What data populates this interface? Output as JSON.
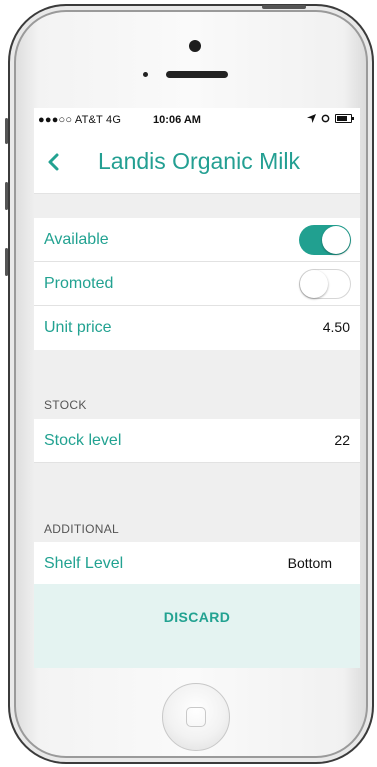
{
  "status_bar": {
    "carrier": "●●●○○ AT&T  4G",
    "time": "10:06 AM"
  },
  "header": {
    "title": "Landis Organic Milk",
    "back_icon": "chevron-left-icon"
  },
  "general": {
    "available_label": "Available",
    "available_on": true,
    "promoted_label": "Promoted",
    "promoted_on": false,
    "unit_price_label": "Unit price",
    "unit_price_value": "4.50"
  },
  "stock": {
    "section_title": "STOCK",
    "level_label": "Stock level",
    "level_value": "22"
  },
  "additional": {
    "section_title": "ADDITIONAL",
    "shelf_label": "Shelf Level",
    "shelf_value": "Bottom"
  },
  "actions": {
    "discard_label": "DISCARD"
  },
  "colors": {
    "accent": "#22a291",
    "toggle_on": "#21a090",
    "discard_bg": "#e4f3f1"
  }
}
